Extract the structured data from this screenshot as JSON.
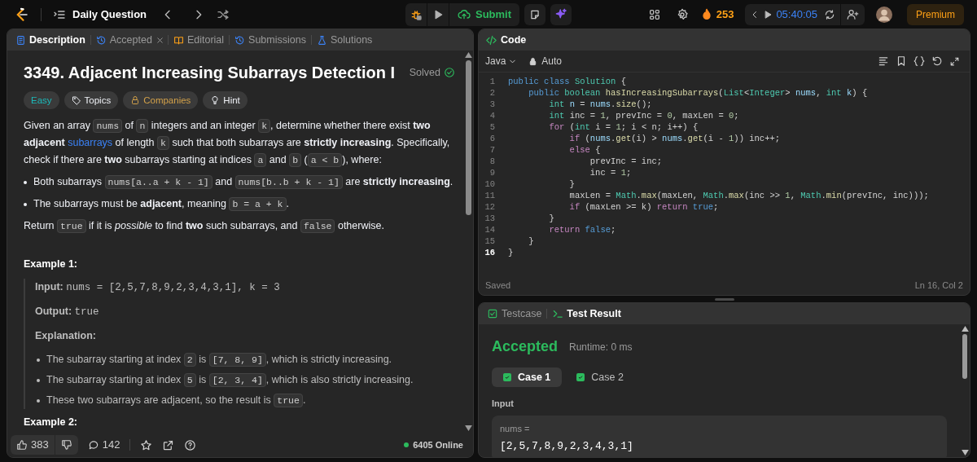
{
  "top_bar": {
    "title": "Daily Question",
    "submit": "Submit",
    "streak": "253",
    "timer": "05:40:05",
    "premium": "Premium"
  },
  "description_tabs": [
    {
      "label": "Description",
      "kind": "description",
      "selected": true,
      "closable": false
    },
    {
      "label": "Accepted",
      "kind": "result",
      "selected": false,
      "closable": true
    },
    {
      "label": "Editorial",
      "kind": "editorial",
      "selected": false,
      "closable": false
    },
    {
      "label": "Submissions",
      "kind": "submissions",
      "selected": false,
      "closable": false
    },
    {
      "label": "Solutions",
      "kind": "solutions",
      "selected": false,
      "closable": false
    }
  ],
  "problem": {
    "title": "3349. Adjacent Increasing Subarrays Detection I",
    "status": "Solved",
    "tags": [
      {
        "label": "Easy",
        "kind": "difficulty"
      },
      {
        "label": "Topics",
        "kind": "topics"
      },
      {
        "label": "Companies",
        "kind": "companies"
      },
      {
        "label": "Hint",
        "kind": "hint"
      }
    ],
    "statement": [
      {
        "kind": "text",
        "text": "Given an array "
      },
      {
        "kind": "code",
        "text": "nums"
      },
      {
        "kind": "text",
        "text": " of "
      },
      {
        "kind": "code",
        "text": "n"
      },
      {
        "kind": "text",
        "text": " integers and an integer "
      },
      {
        "kind": "code",
        "text": "k"
      },
      {
        "kind": "text",
        "text": ", determine whether there exist **two adjacent** "
      },
      {
        "kind": "link",
        "text": "subarrays"
      },
      {
        "kind": "text",
        "text": " of length "
      },
      {
        "kind": "code",
        "text": "k"
      },
      {
        "kind": "text",
        "text": " such that both subarrays are **strictly increasing**. Specifically, check if there are **two** subarrays starting at indices "
      },
      {
        "kind": "code",
        "text": "a"
      },
      {
        "kind": "text",
        "text": " and "
      },
      {
        "kind": "code",
        "text": "b"
      },
      {
        "kind": "text",
        "text": " ("
      },
      {
        "kind": "code",
        "text": "a < b"
      },
      {
        "kind": "text",
        "text": "), where:"
      }
    ],
    "conditions": [
      [
        {
          "kind": "text",
          "text": "Both subarrays "
        },
        {
          "kind": "code",
          "text": "nums[a..a + k - 1]"
        },
        {
          "kind": "text",
          "text": " and "
        },
        {
          "kind": "code",
          "text": "nums[b..b + k - 1]"
        },
        {
          "kind": "text",
          "text": " are **strictly increasing**."
        }
      ],
      [
        {
          "kind": "text",
          "text": "The subarrays must be **adjacent**, meaning "
        },
        {
          "kind": "code",
          "text": "b = a + k"
        },
        {
          "kind": "text",
          "text": "."
        }
      ]
    ],
    "return_note": [
      {
        "kind": "text",
        "text": "Return "
      },
      {
        "kind": "code",
        "text": "true"
      },
      {
        "kind": "text",
        "text": " if it is *possible* to find **two** such subarrays, and "
      },
      {
        "kind": "code",
        "text": "false"
      },
      {
        "kind": "text",
        "text": " otherwise."
      }
    ],
    "example": {
      "heading": "Example 1:",
      "lines": [
        [
          {
            "kind": "text",
            "text": "**Input:** "
          },
          {
            "kind": "mono",
            "text": "nums = [2,5,7,8,9,2,3,4,3,1], k = 3"
          }
        ],
        [
          {
            "kind": "text",
            "text": "**Output:** "
          },
          {
            "kind": "mono",
            "text": "true"
          }
        ],
        [
          {
            "kind": "text",
            "text": "**Explanation:**"
          }
        ]
      ],
      "explanation": [
        [
          {
            "kind": "text",
            "text": "The subarray starting at index "
          },
          {
            "kind": "code",
            "text": "2"
          },
          {
            "kind": "text",
            "text": " is "
          },
          {
            "kind": "code",
            "text": "[7, 8, 9]"
          },
          {
            "kind": "text",
            "text": ", which is strictly increasing."
          }
        ],
        [
          {
            "kind": "text",
            "text": "The subarray starting at index "
          },
          {
            "kind": "code",
            "text": "5"
          },
          {
            "kind": "text",
            "text": " is "
          },
          {
            "kind": "code",
            "text": "[2, 3, 4]"
          },
          {
            "kind": "text",
            "text": ", which is also strictly increasing."
          }
        ],
        [
          {
            "kind": "text",
            "text": "These two subarrays are adjacent, so the result is "
          },
          {
            "kind": "code",
            "text": "true"
          },
          {
            "kind": "text",
            "text": "."
          }
        ]
      ]
    },
    "next_heading": "Example 2:"
  },
  "footer": {
    "likes": "383",
    "comments": "142",
    "online": "6405 Online"
  },
  "editor": {
    "title": "Code",
    "language": "Java",
    "mode": "Auto",
    "status": "Saved",
    "cursor": "Ln 16, Col 2",
    "lines": [
      {
        "number": "1",
        "current": false,
        "tokens": [
          {
            "text": "public class ",
            "kind": "keyword"
          },
          {
            "text": "Solution",
            "kind": "type"
          },
          {
            "text": " {",
            "kind": "plain"
          }
        ]
      },
      {
        "number": "2",
        "current": false,
        "tokens": [
          {
            "text": "    public ",
            "kind": "keyword"
          },
          {
            "text": "boolean ",
            "kind": "type"
          },
          {
            "text": "hasIncreasingSubarrays",
            "kind": "function"
          },
          {
            "text": "(",
            "kind": "plain"
          },
          {
            "text": "List",
            "kind": "type"
          },
          {
            "text": "<",
            "kind": "plain"
          },
          {
            "text": "Integer",
            "kind": "type"
          },
          {
            "text": "> ",
            "kind": "plain"
          },
          {
            "text": "nums",
            "kind": "variable"
          },
          {
            "text": ", ",
            "kind": "plain"
          },
          {
            "text": "int ",
            "kind": "type"
          },
          {
            "text": "k",
            "kind": "variable"
          },
          {
            "text": ") {",
            "kind": "plain"
          }
        ]
      },
      {
        "number": "3",
        "current": false,
        "tokens": [
          {
            "text": "        int ",
            "kind": "type"
          },
          {
            "text": "n",
            "kind": "variable"
          },
          {
            "text": " = ",
            "kind": "plain"
          },
          {
            "text": "nums",
            "kind": "variable"
          },
          {
            "text": ".",
            "kind": "plain"
          },
          {
            "text": "size",
            "kind": "function"
          },
          {
            "text": "();",
            "kind": "plain"
          }
        ]
      },
      {
        "number": "4",
        "current": false,
        "tokens": [
          {
            "text": "        int ",
            "kind": "type"
          },
          {
            "text": "inc = ",
            "kind": "plain"
          },
          {
            "text": "1",
            "kind": "number"
          },
          {
            "text": ", prevInc = ",
            "kind": "plain"
          },
          {
            "text": "0",
            "kind": "number"
          },
          {
            "text": ", maxLen = ",
            "kind": "plain"
          },
          {
            "text": "0",
            "kind": "number"
          },
          {
            "text": ";",
            "kind": "plain"
          }
        ]
      },
      {
        "number": "5",
        "current": false,
        "tokens": [
          {
            "text": "        for ",
            "kind": "control"
          },
          {
            "text": "(",
            "kind": "plain"
          },
          {
            "text": "int ",
            "kind": "type"
          },
          {
            "text": "i = ",
            "kind": "plain"
          },
          {
            "text": "1",
            "kind": "number"
          },
          {
            "text": "; i < n; i++) {",
            "kind": "plain"
          }
        ]
      },
      {
        "number": "6",
        "current": false,
        "tokens": [
          {
            "text": "            if ",
            "kind": "control"
          },
          {
            "text": "(",
            "kind": "plain"
          },
          {
            "text": "nums",
            "kind": "variable"
          },
          {
            "text": ".",
            "kind": "plain"
          },
          {
            "text": "get",
            "kind": "function"
          },
          {
            "text": "(i) > ",
            "kind": "plain"
          },
          {
            "text": "nums",
            "kind": "variable"
          },
          {
            "text": ".",
            "kind": "plain"
          },
          {
            "text": "get",
            "kind": "function"
          },
          {
            "text": "(i - ",
            "kind": "plain"
          },
          {
            "text": "1",
            "kind": "number"
          },
          {
            "text": ")) inc++;",
            "kind": "plain"
          }
        ]
      },
      {
        "number": "7",
        "current": false,
        "tokens": [
          {
            "text": "            else ",
            "kind": "control"
          },
          {
            "text": "{",
            "kind": "plain"
          }
        ]
      },
      {
        "number": "8",
        "current": false,
        "tokens": [
          {
            "text": "                prevInc = inc;",
            "kind": "plain"
          }
        ]
      },
      {
        "number": "9",
        "current": false,
        "tokens": [
          {
            "text": "                inc = ",
            "kind": "plain"
          },
          {
            "text": "1",
            "kind": "number"
          },
          {
            "text": ";",
            "kind": "plain"
          }
        ]
      },
      {
        "number": "10",
        "current": false,
        "tokens": [
          {
            "text": "            }",
            "kind": "plain"
          }
        ]
      },
      {
        "number": "11",
        "current": false,
        "tokens": [
          {
            "text": "            maxLen = ",
            "kind": "plain"
          },
          {
            "text": "Math",
            "kind": "type"
          },
          {
            "text": ".",
            "kind": "plain"
          },
          {
            "text": "max",
            "kind": "function"
          },
          {
            "text": "(maxLen, ",
            "kind": "plain"
          },
          {
            "text": "Math",
            "kind": "type"
          },
          {
            "text": ".",
            "kind": "plain"
          },
          {
            "text": "max",
            "kind": "function"
          },
          {
            "text": "(inc >> ",
            "kind": "plain"
          },
          {
            "text": "1",
            "kind": "number"
          },
          {
            "text": ", ",
            "kind": "plain"
          },
          {
            "text": "Math",
            "kind": "type"
          },
          {
            "text": ".",
            "kind": "plain"
          },
          {
            "text": "min",
            "kind": "function"
          },
          {
            "text": "(prevInc, inc)));",
            "kind": "plain"
          }
        ]
      },
      {
        "number": "12",
        "current": false,
        "tokens": [
          {
            "text": "            if ",
            "kind": "control"
          },
          {
            "text": "(maxLen >= k) ",
            "kind": "plain"
          },
          {
            "text": "return ",
            "kind": "control"
          },
          {
            "text": "true",
            "kind": "keyword"
          },
          {
            "text": ";",
            "kind": "plain"
          }
        ]
      },
      {
        "number": "13",
        "current": false,
        "tokens": [
          {
            "text": "        }",
            "kind": "plain"
          }
        ]
      },
      {
        "number": "14",
        "current": false,
        "tokens": [
          {
            "text": "        return ",
            "kind": "control"
          },
          {
            "text": "false",
            "kind": "keyword"
          },
          {
            "text": ";",
            "kind": "plain"
          }
        ]
      },
      {
        "number": "15",
        "current": false,
        "tokens": [
          {
            "text": "    }",
            "kind": "plain"
          }
        ]
      },
      {
        "number": "16",
        "current": true,
        "tokens": [
          {
            "text": "}",
            "kind": "plain"
          }
        ]
      }
    ]
  },
  "results": {
    "tabs": [
      {
        "label": "Testcase",
        "kind": "testcase",
        "selected": false
      },
      {
        "label": "Test Result",
        "kind": "result",
        "selected": true
      }
    ],
    "verdict": "Accepted",
    "runtime": "Runtime: 0 ms",
    "cases": [
      {
        "label": "Case 1",
        "selected": true,
        "passed": true
      },
      {
        "label": "Case 2",
        "selected": false,
        "passed": true
      }
    ],
    "input_label": "Input",
    "inputs": [
      {
        "name": "nums =",
        "value": "[2,5,7,8,9,2,3,4,3,1]"
      }
    ]
  }
}
